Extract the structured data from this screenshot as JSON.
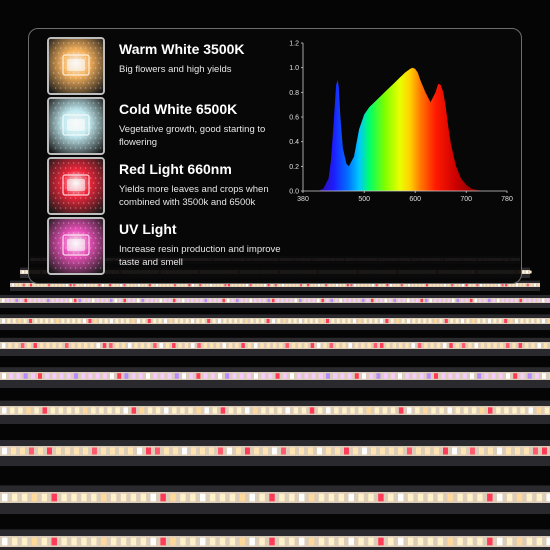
{
  "lights": [
    {
      "title": "Warm White 3500K",
      "description": "Big flowers and high yields",
      "color": "#f7b25c",
      "icon": "warm-white-led-chip-icon"
    },
    {
      "title": "Cold White 6500K",
      "description": "Vegetative growth, good starting to flowering",
      "color": "#bfe9ef",
      "icon": "cold-white-led-chip-icon"
    },
    {
      "title": "Red Light 660nm",
      "description": "Yields more leaves and crops when combined with 3500k and 6500k",
      "color": "#f0253a",
      "icon": "red-led-chip-icon"
    },
    {
      "title": "UV Light",
      "description": "Increase resin production and improve taste and smell",
      "color": "#e94fb8",
      "icon": "uv-led-chip-icon"
    }
  ],
  "chart_data": {
    "type": "area",
    "title": "",
    "xlabel": "",
    "ylabel": "",
    "xlim": [
      380,
      780
    ],
    "ylim": [
      0,
      1.2
    ],
    "x_ticks": [
      380,
      500,
      600,
      700,
      780
    ],
    "y_ticks": [
      "0.0",
      "0.2",
      "0.4",
      "0.6",
      "0.8",
      "1.0",
      "1.2"
    ],
    "grid": false,
    "series": [
      {
        "x": [
          410,
          420,
          430,
          435,
          440,
          445,
          448,
          450,
          453,
          458,
          465,
          470,
          480,
          490,
          500,
          510,
          520,
          530,
          540,
          550,
          560,
          570,
          580,
          590,
          595,
          600,
          605,
          610,
          620,
          630,
          640,
          645,
          650,
          655,
          660,
          665,
          670,
          680,
          690,
          700,
          710,
          720,
          730
        ],
        "values": [
          0.0,
          0.02,
          0.1,
          0.25,
          0.55,
          0.86,
          0.9,
          0.85,
          0.62,
          0.35,
          0.22,
          0.2,
          0.28,
          0.5,
          0.62,
          0.68,
          0.72,
          0.76,
          0.8,
          0.84,
          0.88,
          0.92,
          0.96,
          0.99,
          1.0,
          0.99,
          0.96,
          0.9,
          0.8,
          0.72,
          0.8,
          0.87,
          0.86,
          0.8,
          0.68,
          0.52,
          0.38,
          0.2,
          0.1,
          0.05,
          0.02,
          0.01,
          0.0
        ]
      }
    ]
  }
}
